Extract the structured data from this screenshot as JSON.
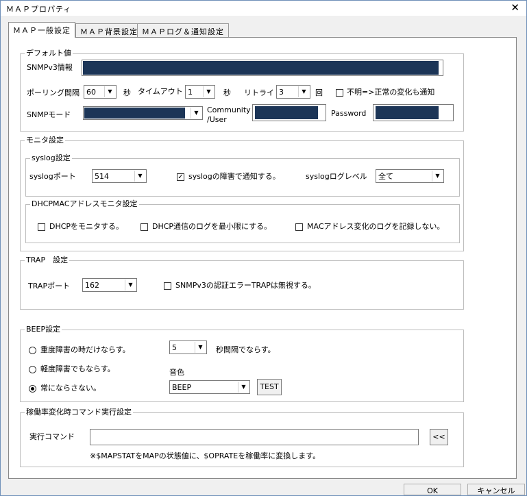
{
  "window": {
    "title": "ＭＡＰプロパティ",
    "close": "✕"
  },
  "tabs": [
    {
      "label": "ＭＡＰ一般設定",
      "active": true
    },
    {
      "label": "ＭＡＰ背景設定",
      "active": false
    },
    {
      "label": "ＭＡＰログ＆通知設定",
      "active": false
    }
  ],
  "default_group": {
    "label": "デフォルト値",
    "snmpv3_info": "SNMPv3情報",
    "polling_label": "ポーリング間隔",
    "polling_value": "60",
    "polling_unit": "秒",
    "timeout_label": "タイムアウト",
    "timeout_value": "1",
    "timeout_unit": "秒",
    "retry_label": "リトライ",
    "retry_value": "3",
    "retry_unit": "回",
    "unknown_notify": "不明=>正常の変化も通知",
    "snmp_mode": "SNMPモード",
    "community_line1": "Community",
    "community_line2": "/User",
    "password": "Password"
  },
  "monitor_group": {
    "label": "モニタ設定",
    "syslog_label": "syslog設定",
    "syslog_port_label": "syslogポート",
    "syslog_port_value": "514",
    "syslog_notify": "syslogの障害で通知する。",
    "syslog_notify_checked": true,
    "syslog_level_label": "syslogログレベル",
    "syslog_level_value": "全て",
    "dhcp_label": "DHCPMACアドレスモニタ設定",
    "dhcp_monitor": "DHCPをモニタする。",
    "dhcp_minlog": "DHCP通信のログを最小限にする。",
    "mac_nolog": "MACアドレス変化のログを記録しない。"
  },
  "trap_group": {
    "label": "TRAP　設定",
    "port_label": "TRAPポート",
    "port_value": "162",
    "ignore": "SNMPv3の認証エラーTRAPは無視する。"
  },
  "beep_group": {
    "label": "BEEP設定",
    "opt_severe": "重度障害の時だけならす。",
    "opt_light": "軽度障害でもならす。",
    "opt_never": "常にならさない。",
    "selected": "opt_never",
    "interval_value": "5",
    "interval_label": "秒間隔でならす。",
    "tone_label": "音色",
    "tone_value": "BEEP",
    "test": "TEST"
  },
  "cmd_group": {
    "label": "稼働率変化時コマンド実行設定",
    "cmd_label": "実行コマンド",
    "cmd_value": "",
    "browse": "<<",
    "note": "※$MAPSTATをMAPの状態値に、$OPRATEを稼働率に変換します。"
  },
  "footer": {
    "ok": "OK",
    "cancel": "キャンセル"
  }
}
